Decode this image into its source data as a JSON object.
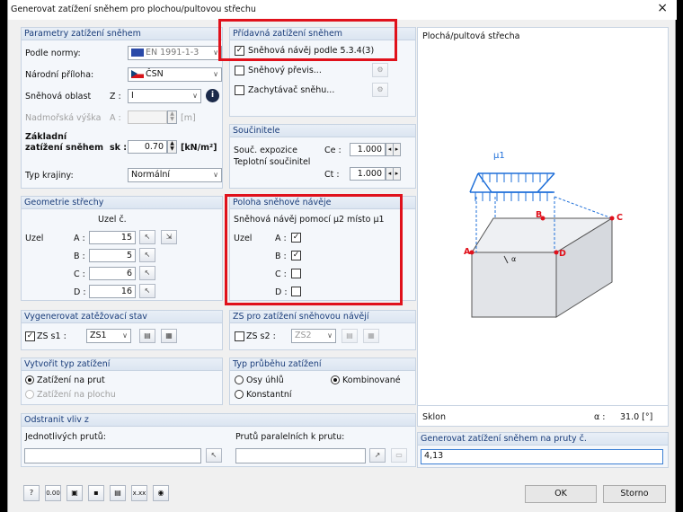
{
  "window": {
    "title": "Generovat zatížení sněhem pro plochou/pultovou střechu",
    "close": "×"
  },
  "params": {
    "header": "Parametry zatížení sněhem",
    "norm_label": "Podle normy:",
    "norm_value": "EN 1991-1-3",
    "annex_label": "Národní příloha:",
    "annex_value": "ČSN",
    "zone_label": "Sněhová oblast",
    "zone_sym": "Z :",
    "zone_value": "I",
    "altitude_label": "Nadmořská výška",
    "altitude_sym": "A :",
    "altitude_unit": "[m]",
    "base_label_1": "Základní",
    "base_label_2": "zatížení sněhem",
    "base_sym": "sk :",
    "base_value": "0.70",
    "base_unit": "[kN/m²]",
    "terrain_label": "Typ krajiny:",
    "terrain_value": "Normální"
  },
  "additional": {
    "header": "Přídavná zatížení sněhem",
    "drift_label": "Sněhová návěj podle 5.3.4(3)",
    "overhang_label": "Sněhový převis...",
    "guard_label": "Zachytávač sněhu..."
  },
  "coeffs": {
    "header": "Součinitele",
    "exposure_label": "Souč. expozice",
    "exposure_sym": "Ce :",
    "exposure_value": "1.000",
    "thermal_label": "Teplotní součinitel",
    "thermal_sym": "Ct :",
    "thermal_value": "1.000"
  },
  "geometry": {
    "header": "Geometrie střechy",
    "node_col": "Uzel č.",
    "row_label": "Uzel",
    "nodes": [
      {
        "name": "A :",
        "value": "15"
      },
      {
        "name": "B :",
        "value": "5"
      },
      {
        "name": "C :",
        "value": "6"
      },
      {
        "name": "D :",
        "value": "16"
      }
    ]
  },
  "drift_pos": {
    "header": "Poloha sněhové návěje",
    "text": "Sněhová návěj pomocí μ2 místo μ1",
    "row_label": "Uzel",
    "nodes": [
      "A :",
      "B :",
      "C :",
      "D :"
    ]
  },
  "loadcase": {
    "header": "Vygenerovat zatěžovací stav",
    "zs_label": "ZS s1 :",
    "zs_value": "ZS1"
  },
  "drift_case": {
    "header": "ZS pro zatížení sněhovou návějí",
    "zs_label": "ZS s2 :",
    "zs_value": "ZS2"
  },
  "load_type": {
    "header": "Vytvořit typ zatížení",
    "opt1": "Zatížení na prut",
    "opt2": "Zatížení na plochu"
  },
  "distribution": {
    "header": "Typ průběhu zatížení",
    "opt1": "Osy úhlů",
    "opt2": "Kombinované",
    "opt3": "Konstantní"
  },
  "remove": {
    "header": "Odstranit vliv z",
    "single_label": "Jednotlivých prutů:",
    "parallel_label": "Prutů paralelních k prutu:"
  },
  "preview": {
    "title": "Plochá/pultová střecha",
    "mu": "μ1",
    "alpha": "α",
    "pts": {
      "A": "A",
      "B": "B",
      "C": "C",
      "D": "D"
    },
    "slope_label": "Sklon",
    "slope_sym": "α :",
    "slope_value": "31.0 [°]"
  },
  "generate": {
    "label": "Generovat zatížení sněhem na pruty č.",
    "value": "4,13"
  },
  "buttons": {
    "ok": "OK",
    "cancel": "Storno"
  },
  "toolbar": {
    "units": "0.00",
    "xxx": "x.xx"
  },
  "colors": {
    "header_text": "#1a3d7a",
    "highlight": "#e0111b",
    "load_arrow": "#1e6fd9"
  }
}
